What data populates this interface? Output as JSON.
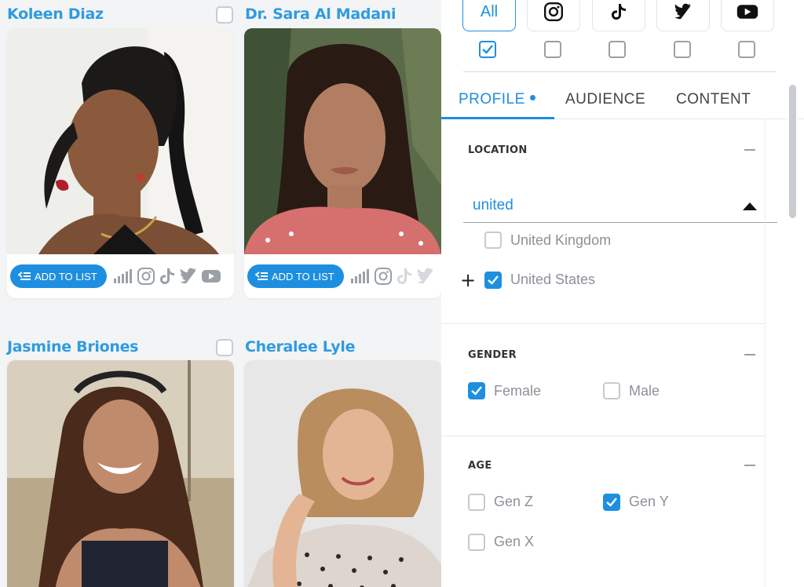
{
  "cards": [
    {
      "name": "Koleen Diaz",
      "add_label": "ADD TO LIST"
    },
    {
      "name": "Dr. Sara Al Madani",
      "add_label": "ADD TO LIST"
    },
    {
      "name": "Jasmine Briones"
    },
    {
      "name": "Cheralee Lyle"
    }
  ],
  "platforms": {
    "all_label": "All",
    "icons": [
      "instagram-icon",
      "tiktok-icon",
      "twitter-icon",
      "youtube-icon"
    ]
  },
  "tabs": [
    {
      "label": "PROFILE",
      "active": true
    },
    {
      "label": "AUDIENCE",
      "active": false
    },
    {
      "label": "CONTENT",
      "active": false
    }
  ],
  "location": {
    "title": "LOCATION",
    "search_value": "united",
    "options": [
      {
        "label": "United Kingdom",
        "checked": false
      },
      {
        "label": "United States",
        "checked": true
      }
    ]
  },
  "gender": {
    "title": "GENDER",
    "options": [
      {
        "label": "Female",
        "checked": true
      },
      {
        "label": "Male",
        "checked": false
      }
    ]
  },
  "age": {
    "title": "AGE",
    "options": [
      {
        "label": "Gen Z",
        "checked": false
      },
      {
        "label": "Gen Y",
        "checked": true
      },
      {
        "label": "Gen X",
        "checked": false
      }
    ]
  },
  "colors": {
    "accent": "#1e8fe0",
    "name": "#2f9be0"
  }
}
